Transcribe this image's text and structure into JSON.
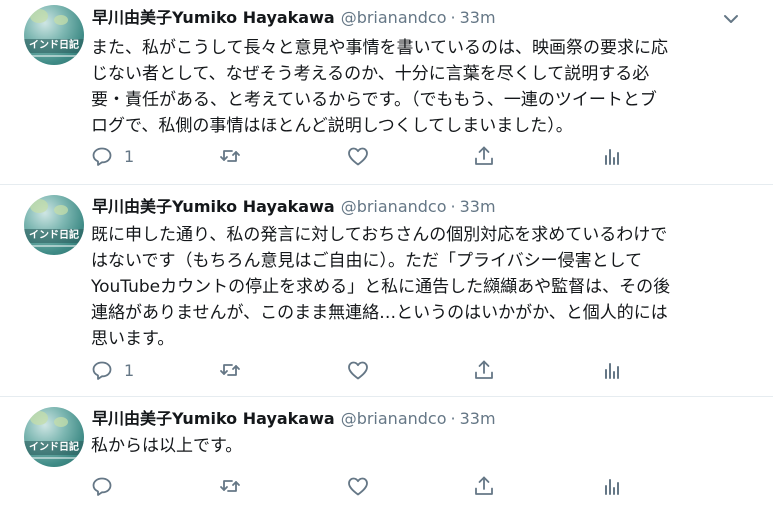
{
  "tweets": [
    {
      "author_name": "早川由美子Yumiko Hayakawa",
      "handle": "@brianandco",
      "separator": "·",
      "time": "33m",
      "avatar_text": "インド日記",
      "text_lines": [
        "また、私がこうして長々と意見や事情を書いているのは、映画祭の要求に応",
        "じない者として、なぜそう考えるのか、十分に言葉を尽くして説明する必",
        "要・責任がある、と考えているからです。（でももう、一連のツイートとブ",
        "ログで、私側の事情はほとんど説明しつくしてしまいました）。"
      ],
      "reply_count": "1",
      "retweet_count": "",
      "like_count": ""
    },
    {
      "author_name": "早川由美子Yumiko Hayakawa",
      "handle": "@brianandco",
      "separator": "·",
      "time": "33m",
      "avatar_text": "インド日記",
      "text_lines": [
        "既に申した通り、私の発言に対しておちさんの個別対応を求めているわけで",
        "はないです（もちろん意見はご自由に）。ただ「プライバシー侵害として",
        "YouTubeカウントの停止を求める」と私に通告した纐纈あや監督は、その後",
        "連絡がありませんが、このまま無連絡…というのはいかがか、と個人的には",
        "思います。"
      ],
      "reply_count": "1",
      "retweet_count": "",
      "like_count": ""
    },
    {
      "author_name": "早川由美子Yumiko Hayakawa",
      "handle": "@brianandco",
      "separator": "·",
      "time": "33m",
      "avatar_text": "インド日記",
      "text_lines": [
        "私からは以上です。"
      ],
      "reply_count": "",
      "retweet_count": "",
      "like_count": ""
    }
  ],
  "icons": {
    "reply": "reply-icon",
    "retweet": "retweet-icon",
    "like": "heart-icon",
    "share": "share-icon",
    "analytics": "analytics-icon",
    "menu": "chevron-down-icon"
  },
  "colors": {
    "icon_gray": "#657786",
    "text": "#14171a",
    "secondary": "#657786",
    "divider": "#e6ecf0"
  }
}
